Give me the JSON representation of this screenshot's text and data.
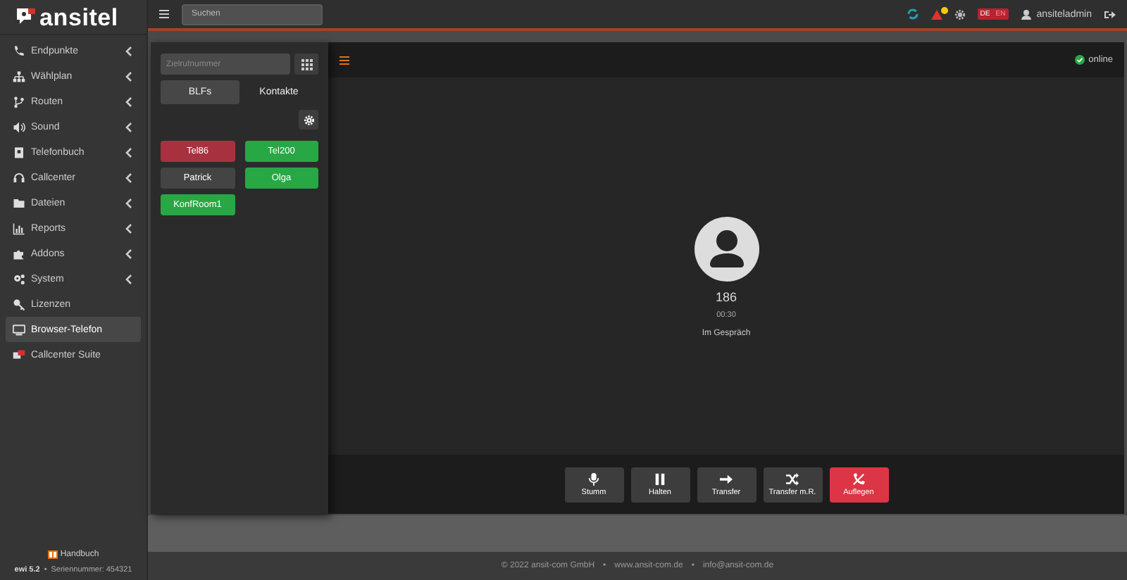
{
  "sidebar": {
    "logo": "ansitel",
    "items": [
      {
        "label": "Endpunkte",
        "kind": "submenu",
        "selected": false
      },
      {
        "label": "Wählplan",
        "kind": "submenu",
        "selected": false
      },
      {
        "label": "Routen",
        "kind": "submenu",
        "selected": false
      },
      {
        "label": "Sound",
        "kind": "submenu",
        "selected": false
      },
      {
        "label": "Telefonbuch",
        "kind": "submenu",
        "selected": false
      },
      {
        "label": "Callcenter",
        "kind": "submenu",
        "selected": false
      },
      {
        "label": "Dateien",
        "kind": "submenu",
        "selected": false
      },
      {
        "label": "Reports",
        "kind": "submenu",
        "selected": false
      },
      {
        "label": "Addons",
        "kind": "submenu",
        "selected": false
      },
      {
        "label": "System",
        "kind": "submenu",
        "selected": false
      },
      {
        "label": "Lizenzen",
        "kind": "link",
        "selected": false
      },
      {
        "label": "Browser-Telefon",
        "kind": "link",
        "selected": true
      },
      {
        "label": "Callcenter Suite",
        "kind": "link",
        "selected": false
      }
    ],
    "manual_link": "Handbuch",
    "version": "ewi 5.2",
    "separator": "•",
    "serial": "Seriennummer: 454321"
  },
  "topbar": {
    "search": {
      "placeholder": "Suchen"
    },
    "languages": [
      {
        "label": "DE",
        "selected": true
      },
      {
        "label": "EN",
        "selected": false
      }
    ],
    "user": "ansiteladmin"
  },
  "dialer": {
    "number_field": {
      "placeholder": "Zielrufnummer"
    },
    "tabs": [
      {
        "label": "BLFs",
        "selected": true
      },
      {
        "label": "Kontakte",
        "selected": false
      }
    ],
    "blfs": [
      {
        "label": "Tel86",
        "color": "#a8313f"
      },
      {
        "label": "Tel200",
        "color": "#28a745"
      },
      {
        "label": "Patrick",
        "color": "#444444"
      },
      {
        "label": "Olga",
        "color": "#28a745"
      },
      {
        "label": "KonfRoom1",
        "color": "#28a745"
      }
    ]
  },
  "call": {
    "status": "online",
    "number": "186",
    "duration": "00:30",
    "state": "Im Gespräch",
    "buttons": [
      {
        "label": "Stumm",
        "kind": "mute"
      },
      {
        "label": "Halten",
        "kind": "hold"
      },
      {
        "label": "Transfer",
        "kind": "transfer"
      },
      {
        "label": "Transfer m.R.",
        "kind": "attended"
      },
      {
        "label": "Auflegen",
        "kind": "hangup"
      }
    ]
  },
  "footer": {
    "separator": "•",
    "items": [
      "© 2022 ansit-com GmbH",
      "www.ansit-com.de",
      "info@ansit-com.de"
    ]
  }
}
